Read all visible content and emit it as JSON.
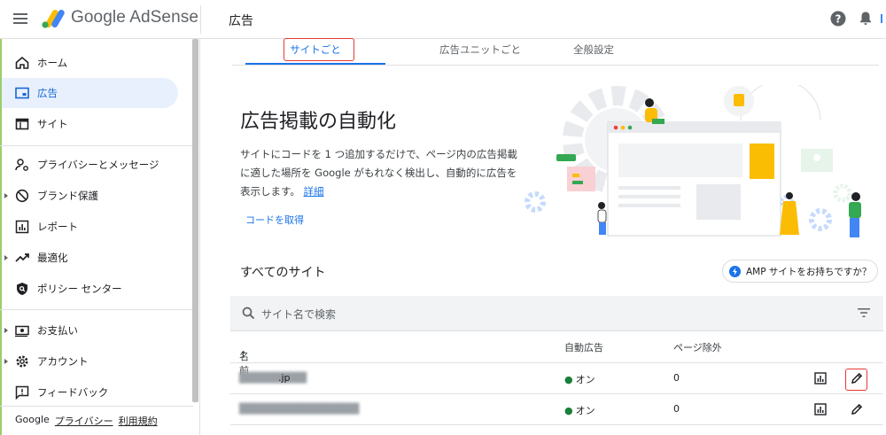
{
  "header": {
    "brand": "Google AdSense",
    "title": "広告"
  },
  "sidebar": {
    "items": [
      {
        "label": "ホーム"
      },
      {
        "label": "広告"
      },
      {
        "label": "サイト"
      },
      {
        "label": "プライバシーとメッセージ"
      },
      {
        "label": "ブランド保護"
      },
      {
        "label": "レポート"
      },
      {
        "label": "最適化"
      },
      {
        "label": "ポリシー センター"
      },
      {
        "label": "お支払い"
      },
      {
        "label": "アカウント"
      },
      {
        "label": "フィードバック"
      }
    ],
    "footer": {
      "google": "Google",
      "privacy": "プライバシー",
      "terms": "利用規約"
    }
  },
  "tabs": [
    {
      "label": "サイトごと"
    },
    {
      "label": "広告ユニットごと"
    },
    {
      "label": "全般設定"
    }
  ],
  "hero": {
    "title": "広告掲載の自動化",
    "desc": "サイトにコードを 1 つ追加するだけで、ページ内の広告掲載に適した場所を Google がもれなく検出し、自動的に広告を表示します。",
    "more": "詳細",
    "get_code": "コードを取得"
  },
  "sites": {
    "title": "すべてのサイト",
    "amp_button": "AMP サイトをお持ちですか？",
    "search_placeholder": "サイト名で検索",
    "columns": {
      "name": "名前",
      "auto_ads": "自動広告",
      "page_exclusions": "ページ除外"
    },
    "rows": [
      {
        "site_suffix": ".jp",
        "auto_ads": "オン",
        "exclusions": "0"
      },
      {
        "site_suffix": "",
        "auto_ads": "オン",
        "exclusions": "0"
      }
    ]
  },
  "colors": {
    "accent": "#1a73e8",
    "active_bg": "#e8f0fe",
    "status_on": "#188038",
    "highlight_box": "#e53935"
  }
}
